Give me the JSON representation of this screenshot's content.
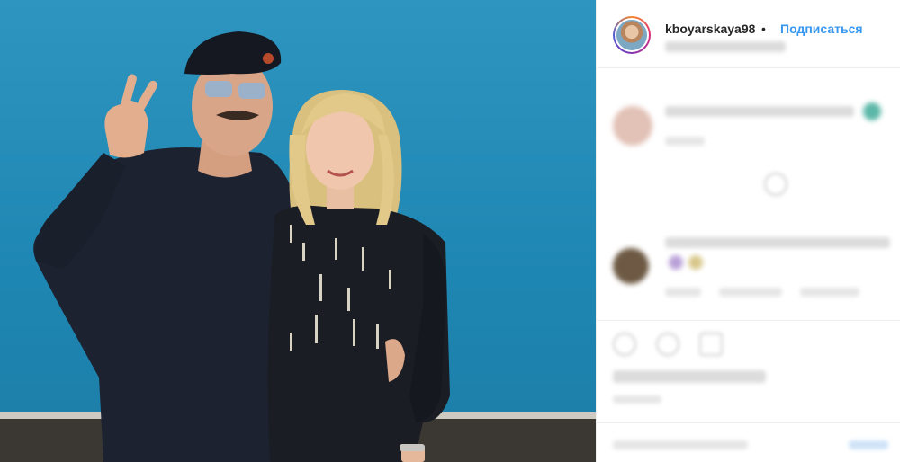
{
  "post": {
    "username": "kboyarskaya98",
    "separator": "•",
    "follow_label": "Подписаться"
  },
  "colors": {
    "follow": "#3897f0",
    "username": "#262626",
    "photo_background": "#2391bd"
  },
  "icons": [
    "avatar",
    "like-icon",
    "comment-icon",
    "share-icon",
    "more-options-icon"
  ]
}
